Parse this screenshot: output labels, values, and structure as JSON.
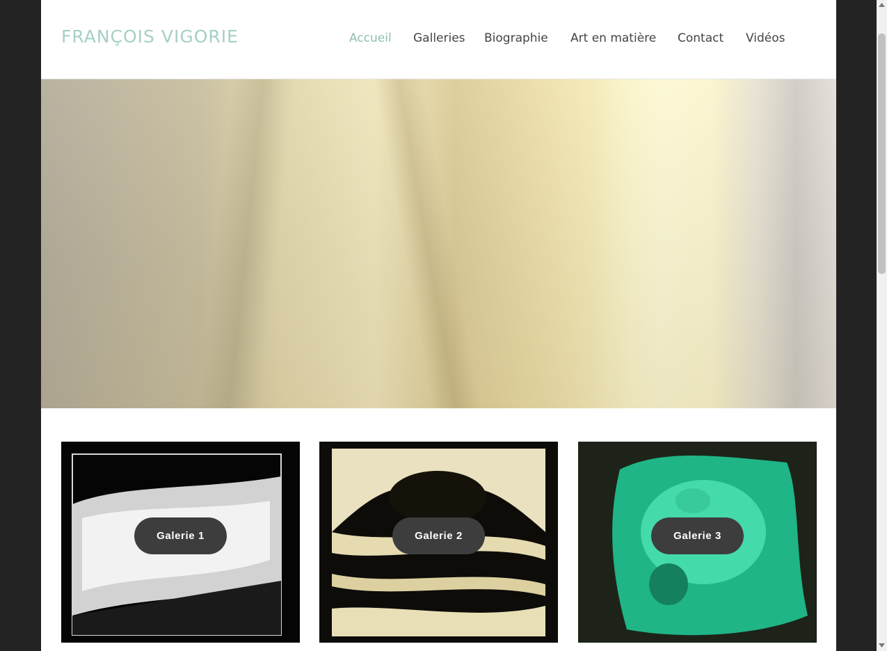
{
  "site": {
    "logo": "FRANÇOIS VIGORIE"
  },
  "nav": {
    "items": [
      {
        "label": "Accueil",
        "active": true
      },
      {
        "label": "Galleries",
        "active": false
      },
      {
        "label": "Biographie",
        "active": false
      },
      {
        "label": "Art en matière",
        "active": false
      },
      {
        "label": "Contact",
        "active": false
      },
      {
        "label": "Vidéos",
        "active": false
      }
    ]
  },
  "hero": {
    "scroll_icon": "chevron-down-icon"
  },
  "galleries": [
    {
      "label": "Galerie 1"
    },
    {
      "label": "Galerie 2"
    },
    {
      "label": "Galerie 3"
    }
  ],
  "colors": {
    "accent": "#8fbfb3",
    "logo": "#a6cfc6",
    "nav_text": "#444444",
    "button_bg": "#3d3d3d",
    "side_background": "#232323"
  }
}
